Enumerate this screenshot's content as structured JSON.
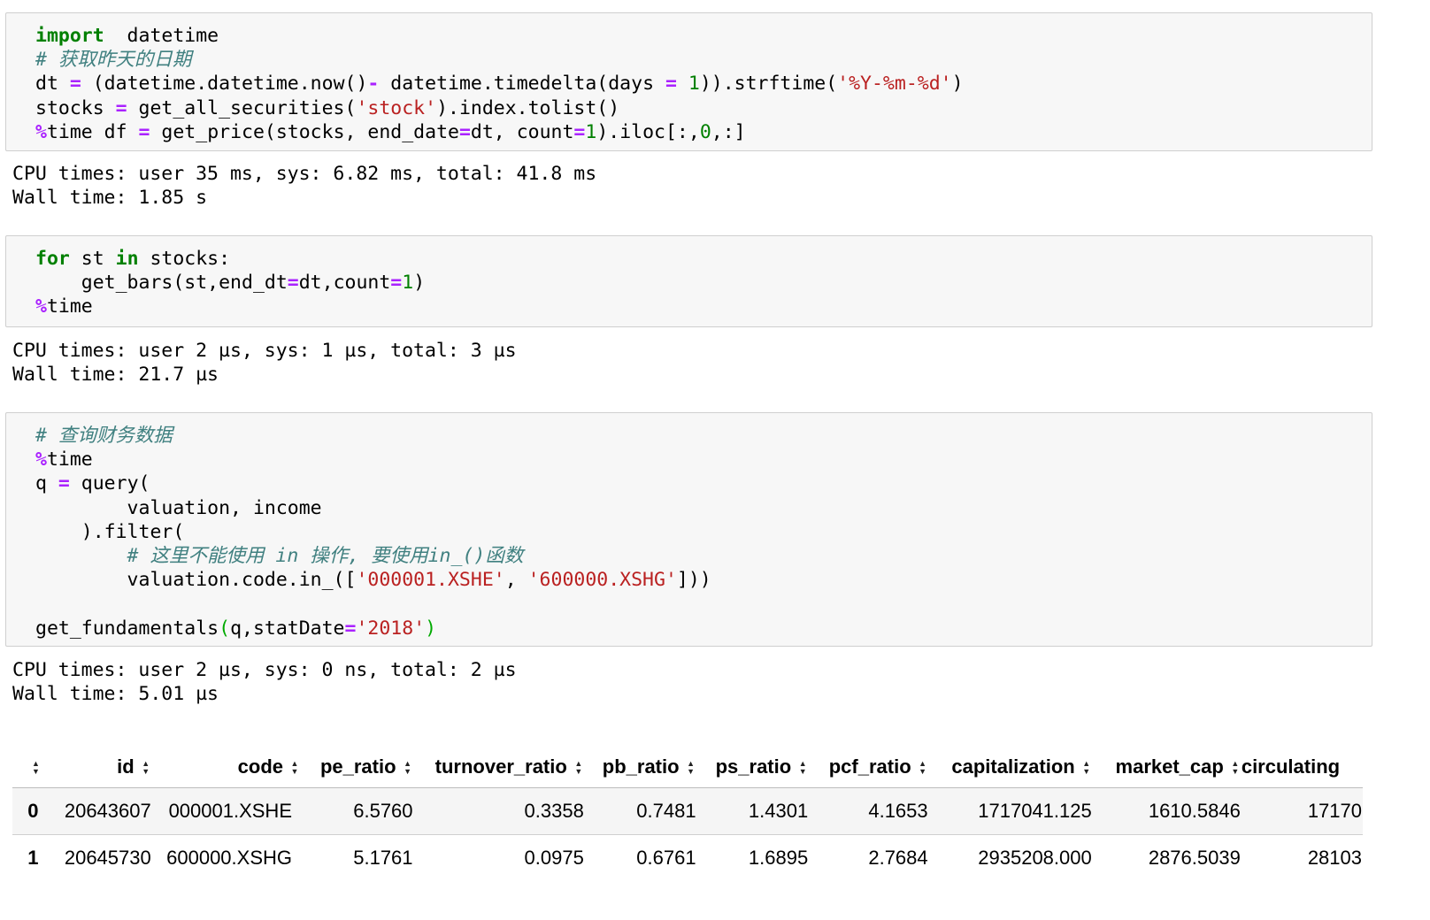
{
  "cell1": {
    "lines": [
      [
        [
          "kw",
          "import"
        ],
        [
          "",
          "  datetime"
        ]
      ],
      [
        [
          "cm",
          "# 获取昨天的日期"
        ]
      ],
      [
        [
          "",
          "dt "
        ],
        [
          "op",
          "="
        ],
        [
          "",
          " (datetime.datetime.now()"
        ],
        [
          "op",
          "-"
        ],
        [
          "",
          " datetime.timedelta(days "
        ],
        [
          "op",
          "="
        ],
        [
          "",
          ""
        ],
        [
          "num",
          " 1"
        ],
        [
          "",
          "))."
        ],
        [
          "",
          "strftime("
        ],
        [
          "str",
          "'%Y-%m-%d'"
        ],
        [
          "",
          ")"
        ]
      ],
      [
        [
          "",
          "stocks "
        ],
        [
          "op",
          "="
        ],
        [
          "",
          " get_all_securities("
        ],
        [
          "str",
          "'stock'"
        ],
        [
          "",
          ").index.tolist()"
        ]
      ],
      [
        [
          "op",
          "%"
        ],
        [
          "",
          "time df "
        ],
        [
          "op",
          "="
        ],
        [
          "",
          " get_price(stocks, end_date"
        ],
        [
          "op",
          "="
        ],
        [
          "",
          "dt, count"
        ],
        [
          "op",
          "="
        ],
        [
          "num",
          "1"
        ],
        [
          "",
          ").iloc[:,"
        ],
        [
          "num",
          "0"
        ],
        [
          "",
          ",:]"
        ]
      ]
    ]
  },
  "out1": [
    "CPU times: user 35 ms, sys: 6.82 ms, total: 41.8 ms",
    "Wall time: 1.85 s"
  ],
  "cell2": {
    "lines": [
      [
        [
          "kw",
          "for"
        ],
        [
          "",
          " st "
        ],
        [
          "kw",
          "in"
        ],
        [
          "",
          " stocks:"
        ]
      ],
      [
        [
          "",
          "    get_bars(st,end_dt"
        ],
        [
          "op",
          "="
        ],
        [
          "",
          "dt,count"
        ],
        [
          "op",
          "="
        ],
        [
          "num",
          "1"
        ],
        [
          "",
          ")"
        ]
      ],
      [
        [
          "op",
          "%"
        ],
        [
          "",
          "time"
        ]
      ]
    ]
  },
  "out2": [
    "CPU times: user 2 µs, sys: 1 µs, total: 3 µs",
    "Wall time: 21.7 µs"
  ],
  "cell3": {
    "lines": [
      [
        [
          "cm",
          "# 查询财务数据"
        ]
      ],
      [
        [
          "op",
          "%"
        ],
        [
          "",
          "time"
        ]
      ],
      [
        [
          "",
          "q "
        ],
        [
          "op",
          "="
        ],
        [
          "",
          " query("
        ]
      ],
      [
        [
          "",
          "        valuation, income"
        ]
      ],
      [
        [
          "",
          "    ).filter("
        ]
      ],
      [
        [
          "cm",
          "        # 这里不能使用 in 操作, 要使用in_()函数"
        ]
      ],
      [
        [
          "",
          "        valuation.code.in_(["
        ],
        [
          "str",
          "'000001.XSHE'"
        ],
        [
          "",
          ", "
        ],
        [
          "str",
          "'600000.XSHG'"
        ],
        [
          "",
          "]))"
        ]
      ],
      [
        [
          "",
          ""
        ]
      ],
      [
        [
          "",
          "get_fundamentals"
        ],
        [
          "br",
          "("
        ],
        [
          "",
          "q,statDate"
        ],
        [
          "op",
          "="
        ],
        [
          "str",
          "'2018'"
        ],
        [
          "br",
          ")"
        ]
      ]
    ]
  },
  "out3": [
    "CPU times: user 2 µs, sys: 0 ns, total: 2 µs",
    "Wall time: 5.01 µs"
  ],
  "table": {
    "columns": [
      "",
      "id",
      "code",
      "pe_ratio",
      "turnover_ratio",
      "pb_ratio",
      "ps_ratio",
      "pcf_ratio",
      "capitalization",
      "market_cap",
      "circulating"
    ],
    "rows": [
      [
        "0",
        "20643607",
        "000001.XSHE",
        "6.5760",
        "0.3358",
        "0.7481",
        "1.4301",
        "4.1653",
        "1717041.125",
        "1610.5846",
        "17170"
      ],
      [
        "1",
        "20645730",
        "600000.XSHG",
        "5.1761",
        "0.0975",
        "0.6761",
        "1.6895",
        "2.7684",
        "2935208.000",
        "2876.5039",
        "28103"
      ]
    ]
  }
}
